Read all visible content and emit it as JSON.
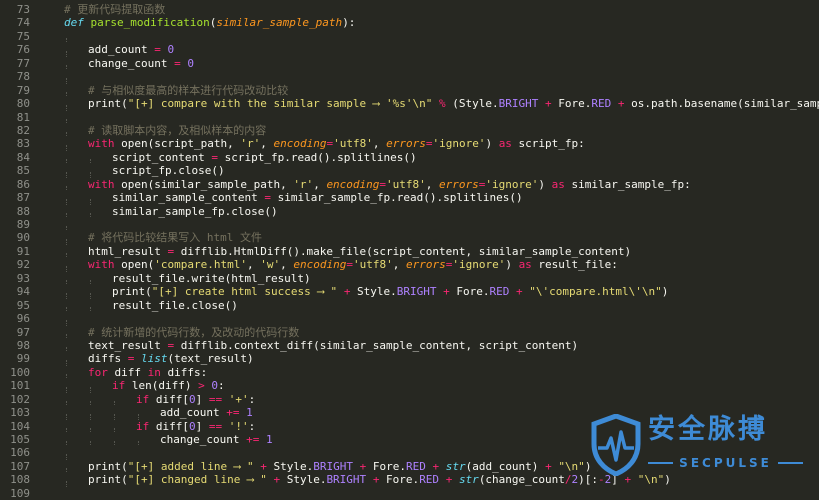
{
  "editor": {
    "lines": [
      {
        "n": "73",
        "indent": 0,
        "tokens": [
          [
            "cmt",
            "# 更新代码提取函数"
          ]
        ]
      },
      {
        "n": "74",
        "indent": 0,
        "tokens": [
          [
            "def",
            "def "
          ],
          [
            "fn",
            "parse_modification"
          ],
          [
            "plain",
            "("
          ],
          [
            "arg",
            "similar_sample_path"
          ],
          [
            "plain",
            "):"
          ]
        ]
      },
      {
        "n": "75",
        "indent": 1,
        "tokens": []
      },
      {
        "n": "76",
        "indent": 1,
        "tokens": [
          [
            "plain",
            "add_count "
          ],
          [
            "op",
            "="
          ],
          [
            "plain",
            " "
          ],
          [
            "num",
            "0"
          ]
        ]
      },
      {
        "n": "77",
        "indent": 1,
        "tokens": [
          [
            "plain",
            "change_count "
          ],
          [
            "op",
            "="
          ],
          [
            "plain",
            " "
          ],
          [
            "num",
            "0"
          ]
        ]
      },
      {
        "n": "78",
        "indent": 1,
        "tokens": []
      },
      {
        "n": "79",
        "indent": 1,
        "tokens": [
          [
            "cmt",
            "# 与相似度最高的样本进行代码改动比较"
          ]
        ]
      },
      {
        "n": "80",
        "indent": 1,
        "tokens": [
          [
            "plain",
            "print("
          ],
          [
            "str",
            "\"[+] compare with the similar sample ⟶ '%s'\\n\""
          ],
          [
            "plain",
            " "
          ],
          [
            "op",
            "%"
          ],
          [
            "plain",
            " (Style."
          ],
          [
            "const",
            "BRIGHT"
          ],
          [
            "plain",
            " "
          ],
          [
            "op",
            "+"
          ],
          [
            "plain",
            " Fore."
          ],
          [
            "const",
            "RED"
          ],
          [
            "plain",
            " "
          ],
          [
            "op",
            "+"
          ],
          [
            "plain",
            " os.path.basename(similar_sample_path)))"
          ]
        ]
      },
      {
        "n": "81",
        "indent": 1,
        "tokens": []
      },
      {
        "n": "82",
        "indent": 1,
        "tokens": [
          [
            "cmt",
            "# 读取脚本内容，及相似样本的内容"
          ]
        ]
      },
      {
        "n": "83",
        "indent": 1,
        "tokens": [
          [
            "kw",
            "with"
          ],
          [
            "plain",
            " open(script_path, "
          ],
          [
            "str",
            "'r'"
          ],
          [
            "plain",
            ", "
          ],
          [
            "arg",
            "encoding"
          ],
          [
            "op",
            "="
          ],
          [
            "str",
            "'utf8'"
          ],
          [
            "plain",
            ", "
          ],
          [
            "arg",
            "errors"
          ],
          [
            "op",
            "="
          ],
          [
            "str",
            "'ignore'"
          ],
          [
            "plain",
            ") "
          ],
          [
            "kw",
            "as"
          ],
          [
            "plain",
            " script_fp:"
          ]
        ]
      },
      {
        "n": "84",
        "indent": 2,
        "tokens": [
          [
            "plain",
            "script_content "
          ],
          [
            "op",
            "="
          ],
          [
            "plain",
            " script_fp.read().splitlines()"
          ]
        ]
      },
      {
        "n": "85",
        "indent": 2,
        "tokens": [
          [
            "plain",
            "script_fp.close()"
          ]
        ]
      },
      {
        "n": "86",
        "indent": 1,
        "tokens": [
          [
            "kw",
            "with"
          ],
          [
            "plain",
            " open(similar_sample_path, "
          ],
          [
            "str",
            "'r'"
          ],
          [
            "plain",
            ", "
          ],
          [
            "arg",
            "encoding"
          ],
          [
            "op",
            "="
          ],
          [
            "str",
            "'utf8'"
          ],
          [
            "plain",
            ", "
          ],
          [
            "arg",
            "errors"
          ],
          [
            "op",
            "="
          ],
          [
            "str",
            "'ignore'"
          ],
          [
            "plain",
            ") "
          ],
          [
            "kw",
            "as"
          ],
          [
            "plain",
            " similar_sample_fp:"
          ]
        ]
      },
      {
        "n": "87",
        "indent": 2,
        "tokens": [
          [
            "plain",
            "similar_sample_content "
          ],
          [
            "op",
            "="
          ],
          [
            "plain",
            " similar_sample_fp.read().splitlines()"
          ]
        ]
      },
      {
        "n": "88",
        "indent": 2,
        "tokens": [
          [
            "plain",
            "similar_sample_fp.close()"
          ]
        ]
      },
      {
        "n": "89",
        "indent": 1,
        "tokens": []
      },
      {
        "n": "90",
        "indent": 1,
        "tokens": [
          [
            "cmt",
            "# 将代码比较结果写入 html 文件"
          ]
        ]
      },
      {
        "n": "91",
        "indent": 1,
        "tokens": [
          [
            "plain",
            "html_result "
          ],
          [
            "op",
            "="
          ],
          [
            "plain",
            " difflib.HtmlDiff().make_file(script_content, similar_sample_content)"
          ]
        ]
      },
      {
        "n": "92",
        "indent": 1,
        "tokens": [
          [
            "kw",
            "with"
          ],
          [
            "plain",
            " open("
          ],
          [
            "str",
            "'compare.html'"
          ],
          [
            "plain",
            ", "
          ],
          [
            "str",
            "'w'"
          ],
          [
            "plain",
            ", "
          ],
          [
            "arg",
            "encoding"
          ],
          [
            "op",
            "="
          ],
          [
            "str",
            "'utf8'"
          ],
          [
            "plain",
            ", "
          ],
          [
            "arg",
            "errors"
          ],
          [
            "op",
            "="
          ],
          [
            "str",
            "'ignore'"
          ],
          [
            "plain",
            ") "
          ],
          [
            "kw",
            "as"
          ],
          [
            "plain",
            " result_file:"
          ]
        ]
      },
      {
        "n": "93",
        "indent": 2,
        "tokens": [
          [
            "plain",
            "result_file.write(html_result)"
          ]
        ]
      },
      {
        "n": "94",
        "indent": 2,
        "tokens": [
          [
            "plain",
            "print("
          ],
          [
            "str",
            "\"[+] create html success ⟶ \""
          ],
          [
            "plain",
            " "
          ],
          [
            "op",
            "+"
          ],
          [
            "plain",
            " Style."
          ],
          [
            "const",
            "BRIGHT"
          ],
          [
            "plain",
            " "
          ],
          [
            "op",
            "+"
          ],
          [
            "plain",
            " Fore."
          ],
          [
            "const",
            "RED"
          ],
          [
            "plain",
            " "
          ],
          [
            "op",
            "+"
          ],
          [
            "plain",
            " "
          ],
          [
            "str",
            "\"\\'compare.html\\'\\n\""
          ],
          [
            "plain",
            ")"
          ]
        ]
      },
      {
        "n": "95",
        "indent": 2,
        "tokens": [
          [
            "plain",
            "result_file.close()"
          ]
        ]
      },
      {
        "n": "96",
        "indent": 1,
        "tokens": []
      },
      {
        "n": "97",
        "indent": 1,
        "tokens": [
          [
            "cmt",
            "# 统计新增的代码行数，及改动的代码行数"
          ]
        ]
      },
      {
        "n": "98",
        "indent": 1,
        "tokens": [
          [
            "plain",
            "text_result "
          ],
          [
            "op",
            "="
          ],
          [
            "plain",
            " difflib.context_diff(similar_sample_content, script_content)"
          ]
        ]
      },
      {
        "n": "99",
        "indent": 1,
        "tokens": [
          [
            "plain",
            "diffs "
          ],
          [
            "op",
            "="
          ],
          [
            "plain",
            " "
          ],
          [
            "builtin",
            "list"
          ],
          [
            "plain",
            "(text_result)"
          ]
        ]
      },
      {
        "n": "100",
        "indent": 1,
        "tokens": [
          [
            "kw",
            "for"
          ],
          [
            "plain",
            " diff "
          ],
          [
            "kw",
            "in"
          ],
          [
            "plain",
            " diffs:"
          ]
        ]
      },
      {
        "n": "101",
        "indent": 2,
        "tokens": [
          [
            "kw",
            "if"
          ],
          [
            "plain",
            " len(diff) "
          ],
          [
            "op",
            ">"
          ],
          [
            "plain",
            " "
          ],
          [
            "num",
            "0"
          ],
          [
            "plain",
            ":"
          ]
        ]
      },
      {
        "n": "102",
        "indent": 3,
        "tokens": [
          [
            "kw",
            "if"
          ],
          [
            "plain",
            " diff["
          ],
          [
            "num",
            "0"
          ],
          [
            "plain",
            "] "
          ],
          [
            "op",
            "=="
          ],
          [
            "plain",
            " "
          ],
          [
            "str",
            "'+'"
          ],
          [
            "plain",
            ":"
          ]
        ]
      },
      {
        "n": "103",
        "indent": 4,
        "tokens": [
          [
            "plain",
            "add_count "
          ],
          [
            "op",
            "+="
          ],
          [
            "plain",
            " "
          ],
          [
            "num",
            "1"
          ]
        ]
      },
      {
        "n": "104",
        "indent": 3,
        "tokens": [
          [
            "kw",
            "if"
          ],
          [
            "plain",
            " diff["
          ],
          [
            "num",
            "0"
          ],
          [
            "plain",
            "] "
          ],
          [
            "op",
            "=="
          ],
          [
            "plain",
            " "
          ],
          [
            "str",
            "'!'"
          ],
          [
            "plain",
            ":"
          ]
        ]
      },
      {
        "n": "105",
        "indent": 4,
        "tokens": [
          [
            "plain",
            "change_count "
          ],
          [
            "op",
            "+="
          ],
          [
            "plain",
            " "
          ],
          [
            "num",
            "1"
          ]
        ]
      },
      {
        "n": "106",
        "indent": 1,
        "tokens": []
      },
      {
        "n": "107",
        "indent": 1,
        "tokens": [
          [
            "plain",
            "print("
          ],
          [
            "str",
            "\"[+] added line ⟶ \""
          ],
          [
            "plain",
            " "
          ],
          [
            "op",
            "+"
          ],
          [
            "plain",
            " Style."
          ],
          [
            "const",
            "BRIGHT"
          ],
          [
            "plain",
            " "
          ],
          [
            "op",
            "+"
          ],
          [
            "plain",
            " Fore."
          ],
          [
            "const",
            "RED"
          ],
          [
            "plain",
            " "
          ],
          [
            "op",
            "+"
          ],
          [
            "plain",
            " "
          ],
          [
            "builtin",
            "str"
          ],
          [
            "plain",
            "(add_count) "
          ],
          [
            "op",
            "+"
          ],
          [
            "plain",
            " "
          ],
          [
            "str",
            "\"\\n\""
          ],
          [
            "plain",
            ")"
          ]
        ]
      },
      {
        "n": "108",
        "indent": 1,
        "tokens": [
          [
            "plain",
            "print("
          ],
          [
            "str",
            "\"[+] changed line ⟶ \""
          ],
          [
            "plain",
            " "
          ],
          [
            "op",
            "+"
          ],
          [
            "plain",
            " Style."
          ],
          [
            "const",
            "BRIGHT"
          ],
          [
            "plain",
            " "
          ],
          [
            "op",
            "+"
          ],
          [
            "plain",
            " Fore."
          ],
          [
            "const",
            "RED"
          ],
          [
            "plain",
            " "
          ],
          [
            "op",
            "+"
          ],
          [
            "plain",
            " "
          ],
          [
            "builtin",
            "str"
          ],
          [
            "plain",
            "(change_count"
          ],
          [
            "op",
            "/"
          ],
          [
            "num",
            "2"
          ],
          [
            "plain",
            ")[:"
          ],
          [
            "op",
            "-"
          ],
          [
            "num",
            "2"
          ],
          [
            "plain",
            "] "
          ],
          [
            "op",
            "+"
          ],
          [
            "plain",
            " "
          ],
          [
            "str",
            "\"\\n\""
          ],
          [
            "plain",
            ")"
          ]
        ]
      },
      {
        "n": "109",
        "indent": 0,
        "tokens": []
      }
    ]
  },
  "watermark": {
    "name_cn": "安全脉搏",
    "name_en": "SECPULSE",
    "color": "#3e8bd6",
    "icon": "shield-pulse-icon"
  },
  "theme": {
    "background": "#272822",
    "keyword": "#f92672",
    "function": "#a6e22e",
    "string": "#e6db74",
    "number": "#ae81ff",
    "comment": "#75715e",
    "argument": "#fd971f"
  }
}
